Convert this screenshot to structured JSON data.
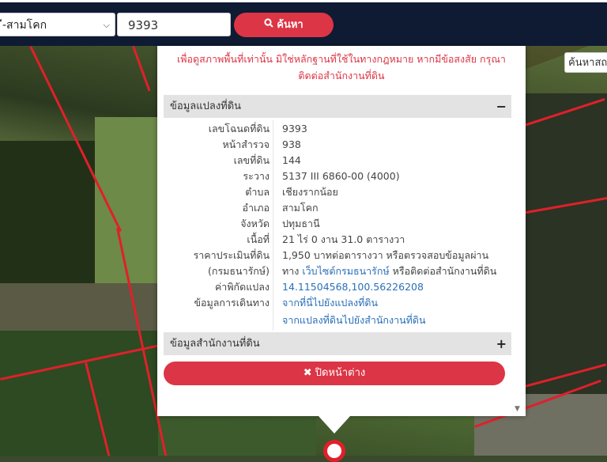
{
  "toolbar": {
    "province_select": "ี-สามโคก",
    "search_value": "9393",
    "search_label": "ค้นหา"
  },
  "map": {
    "search_placeholder": "ค้นหาสถ"
  },
  "popup": {
    "warning_line1": "เพื่อดูสภาพพื้นที่เท่านั้น มิใช่หลักฐานที่ใช้ในทางกฎหมาย หากมีข้อสงสัย กรุณา",
    "warning_line2": "ติดต่อสำนักงานที่ดิน",
    "land_section_title": "ข้อมูลแปลงที่ดิน",
    "land_section_toggle": "−",
    "office_section_title": "ข้อมูลสำนักงานที่ดิน",
    "office_section_toggle": "+",
    "rows": [
      {
        "label": "เลขโฉนดที่ดิน",
        "value": "9393"
      },
      {
        "label": "หน้าสำรวจ",
        "value": "938"
      },
      {
        "label": "เลขที่ดิน",
        "value": "144"
      },
      {
        "label": "ระวาง",
        "value": "5137 III 6860-00 (4000)"
      },
      {
        "label": "ตำบล",
        "value": "เชียงรากน้อย"
      },
      {
        "label": "อำเภอ",
        "value": "สามโคก"
      },
      {
        "label": "จังหวัด",
        "value": "ปทุมธานี"
      },
      {
        "label": "เนื้อที่",
        "value": "21 ไร่ 0 งาน 31.0 ตารางวา"
      },
      {
        "label": "ราคาประเมินที่ดิน",
        "value": "1,950 บาทต่อตารางวา หรือตรวจสอบข้อมูลผ่าน"
      },
      {
        "label": "(กรมธนารักษ์)",
        "value_prefix": "ทาง ",
        "value_link": "เว็บไซต์กรมธนารักษ์",
        "value_suffix": " หรือติดต่อสำนักงานที่ดิน"
      },
      {
        "label": "ค่าพิกัดแปลง",
        "value_link": "14.11504568,100.56226208"
      },
      {
        "label": "ข้อมูลการเดินทาง",
        "value_link": "จากที่นี่ไปยังแปลงที่ดิน"
      },
      {
        "label": "",
        "value_link": "จากแปลงที่ดินไปยังสำนักงานที่ดิน"
      }
    ],
    "close_label": "ปิดหน้าต่าง"
  },
  "colors": {
    "topbar": "#0e1b33",
    "accent": "#dc3545",
    "link": "#2a6fb8",
    "parcel_line": "#e0202a"
  },
  "icons": {
    "search": "search-icon",
    "close": "close-icon",
    "chevron": "chevron-down-icon",
    "pin": "map-pin-icon"
  }
}
